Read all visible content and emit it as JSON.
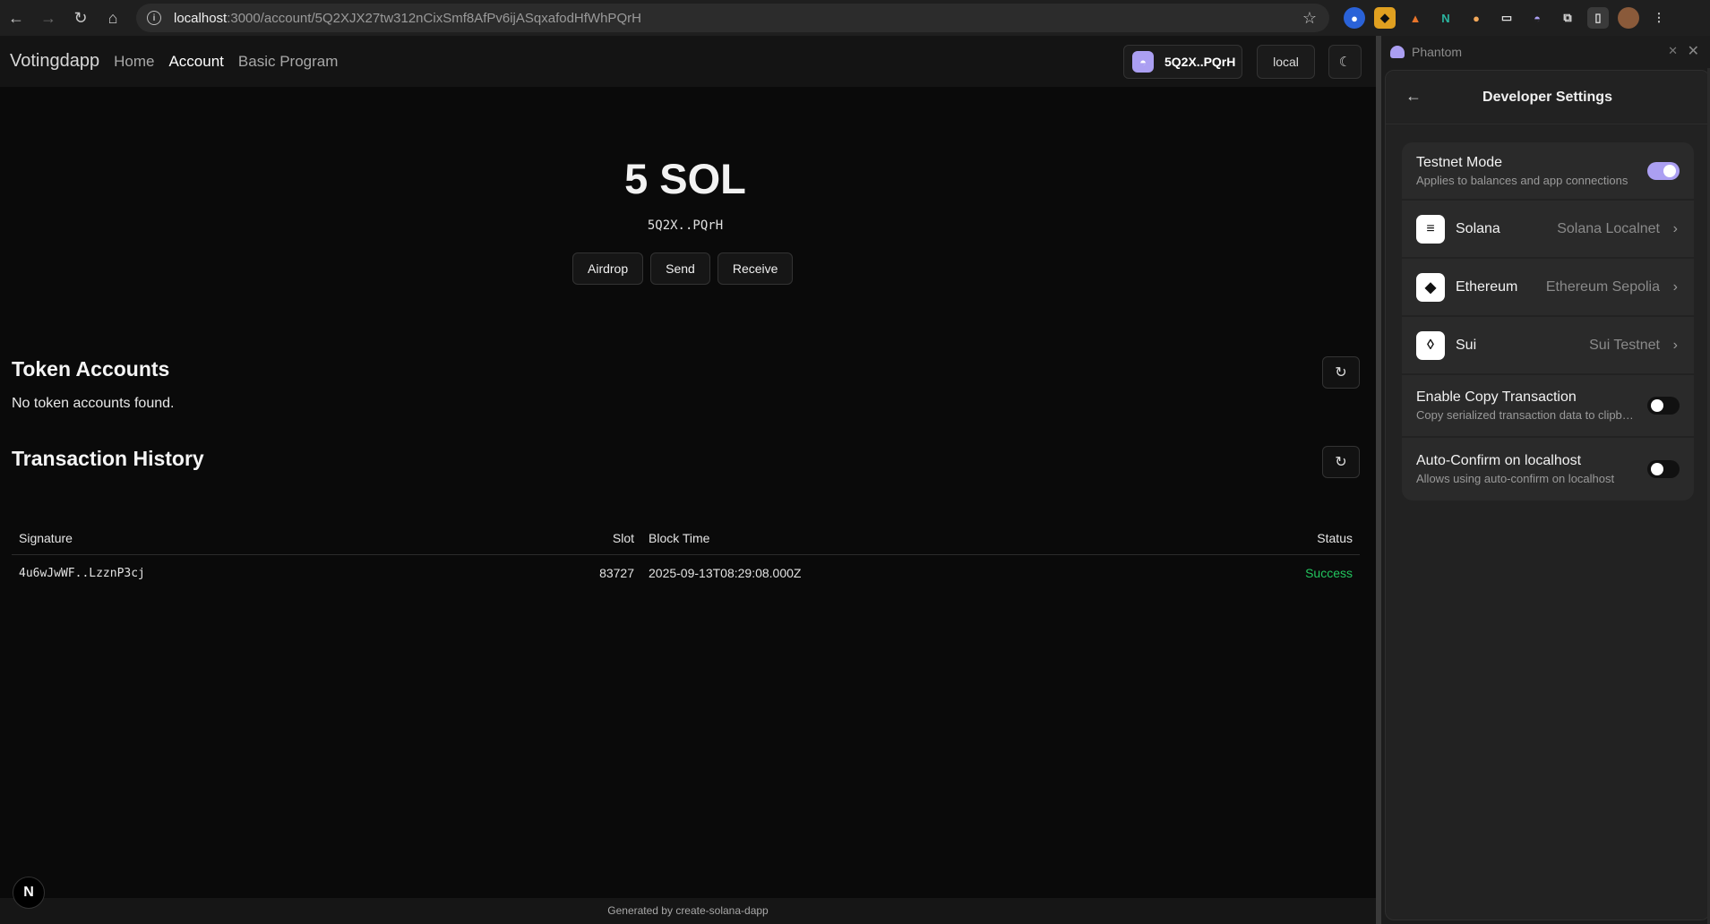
{
  "browser": {
    "url_host": "localhost",
    "url_path": ":3000/account/5Q2XJX27tw312nCixSmf8AfPv6ijASqxafodHfWhPQrH"
  },
  "app": {
    "brand": "Votingdapp",
    "nav": [
      "Home",
      "Account",
      "Basic Program"
    ],
    "active_nav": "Account",
    "wallet_label": "5Q2X..PQrH",
    "cluster_label": "local",
    "balance": "5 SOL",
    "address": "5Q2X..PQrH",
    "actions": {
      "airdrop": "Airdrop",
      "send": "Send",
      "receive": "Receive"
    },
    "token_accounts": {
      "title": "Token Accounts",
      "empty": "No token accounts found."
    },
    "tx_history": {
      "title": "Transaction History",
      "columns": {
        "signature": "Signature",
        "slot": "Slot",
        "block_time": "Block Time",
        "status": "Status"
      },
      "rows": [
        {
          "signature": "4u6wJwWF..LzznP3cj",
          "slot": "83727",
          "block_time": "2025-09-13T08:29:08.000Z",
          "status": "Success"
        }
      ]
    },
    "footer": "Generated by create-solana-dapp",
    "next_badge": "N"
  },
  "phantom": {
    "window_title": "Phantom",
    "panel_title": "Developer Settings",
    "testnet_mode": {
      "title": "Testnet Mode",
      "subtitle": "Applies to balances and app connections",
      "on": true
    },
    "chains": [
      {
        "name": "Solana",
        "network": "Solana Localnet",
        "icon": "solana-icon"
      },
      {
        "name": "Ethereum",
        "network": "Ethereum Sepolia",
        "icon": "ethereum-icon"
      },
      {
        "name": "Sui",
        "network": "Sui Testnet",
        "icon": "sui-icon"
      }
    ],
    "copy_tx": {
      "title": "Enable Copy Transaction",
      "subtitle": "Copy serialized transaction data to clipboard",
      "on": false
    },
    "auto_confirm": {
      "title": "Auto-Confirm on localhost",
      "subtitle": "Allows using auto-confirm on localhost",
      "on": false
    }
  },
  "colors": {
    "accent": "#ab9ff2",
    "success": "#22c55e",
    "background": "#0a0a0a"
  }
}
